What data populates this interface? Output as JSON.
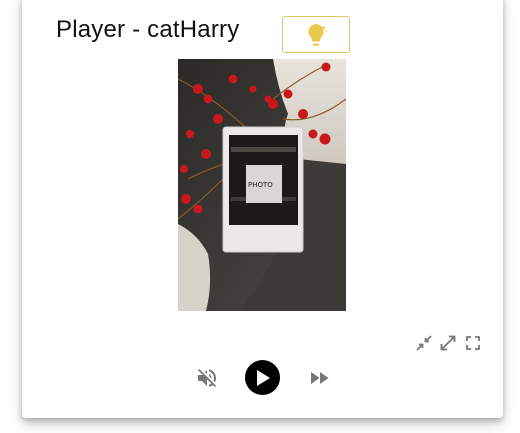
{
  "player": {
    "title": "Player - catHarry",
    "accent_color": "#e3c766",
    "icons": {
      "light": "lightbulb-icon",
      "collapse": "collapse-icon",
      "expand": "expand-icon",
      "fullscreen": "fullscreen-icon",
      "mute": "volume-off-icon",
      "play": "play-icon",
      "forward": "fast-forward-icon"
    }
  }
}
